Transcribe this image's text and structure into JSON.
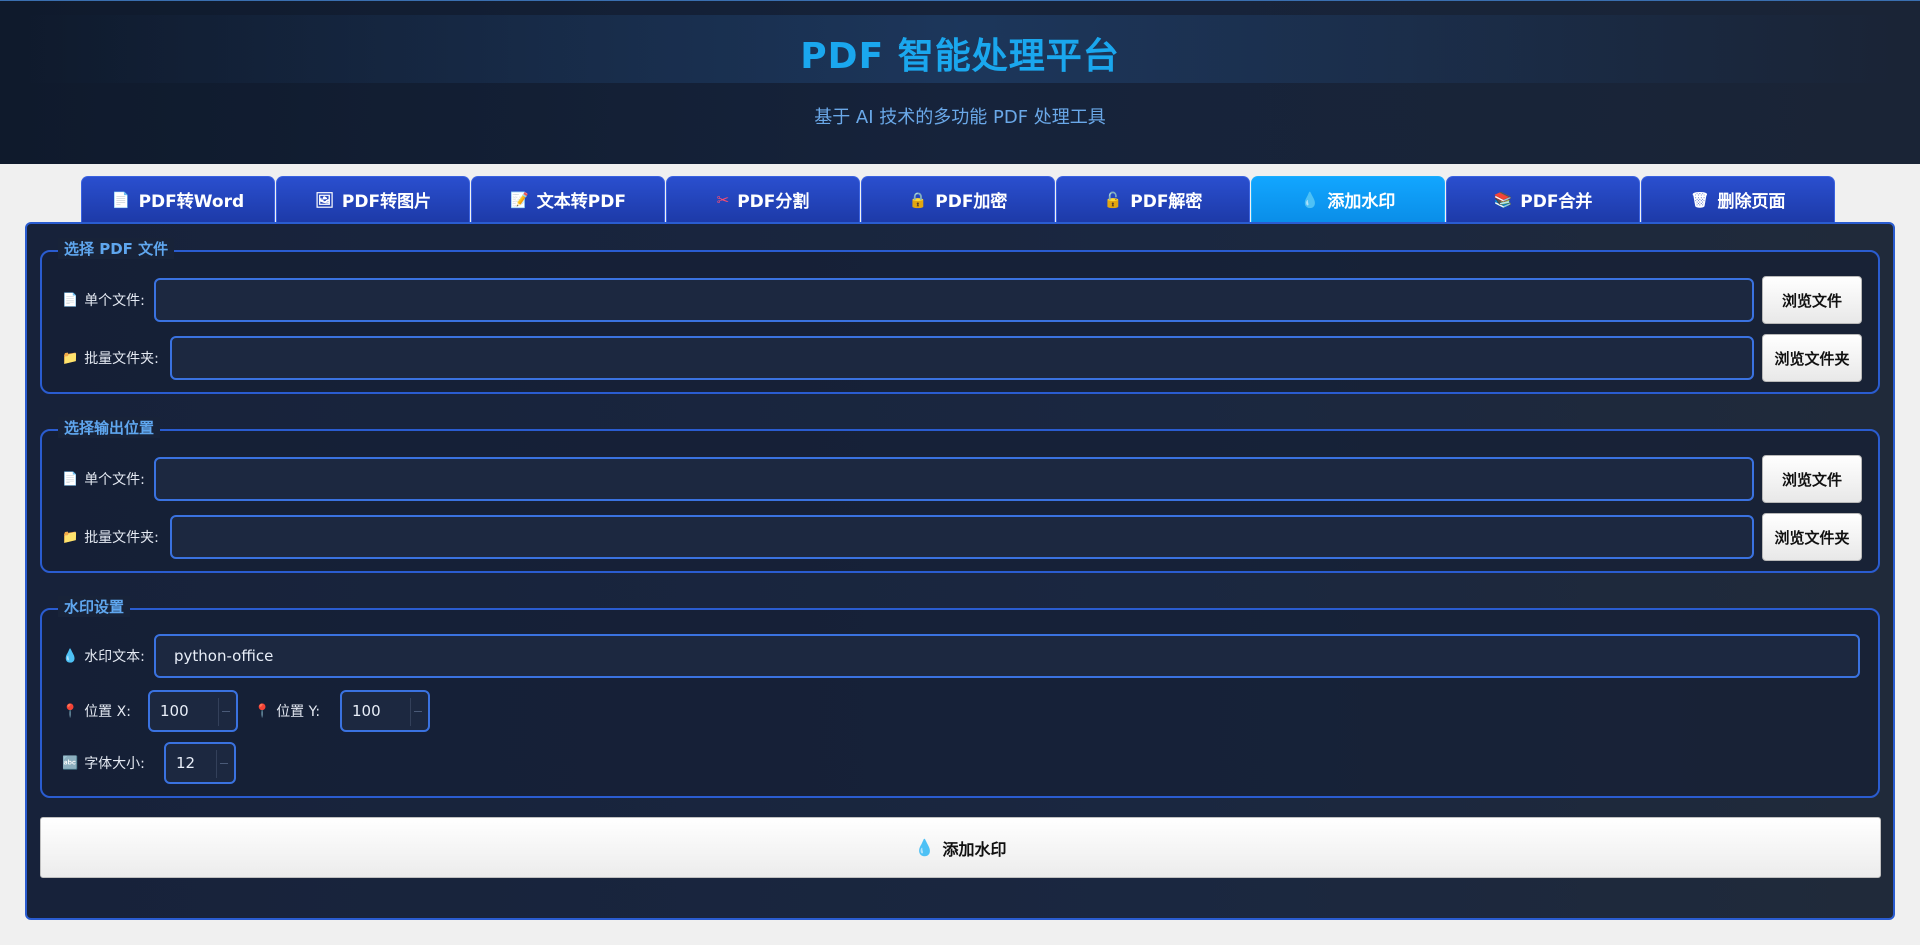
{
  "header": {
    "title": "PDF 智能处理平台",
    "subtitle": "基于 AI 技术的多功能 PDF 处理工具"
  },
  "tabs": [
    {
      "label": "PDF转Word",
      "icon": "📄",
      "icon_name": "document-icon"
    },
    {
      "label": "PDF转图片",
      "icon": "🖼",
      "icon_name": "image-icon"
    },
    {
      "label": "文本转PDF",
      "icon": "📝",
      "icon_name": "memo-icon"
    },
    {
      "label": "PDF分割",
      "icon": "✂",
      "icon_name": "scissors-icon"
    },
    {
      "label": "PDF加密",
      "icon": "🔒",
      "icon_name": "lock-icon"
    },
    {
      "label": "PDF解密",
      "icon": "🔓",
      "icon_name": "unlock-icon"
    },
    {
      "label": "添加水印",
      "icon": "💧",
      "icon_name": "droplet-icon",
      "active": true
    },
    {
      "label": "PDF合并",
      "icon": "📚",
      "icon_name": "books-icon"
    },
    {
      "label": "删除页面",
      "icon": "🗑",
      "icon_name": "trash-icon"
    }
  ],
  "input_group": {
    "title": "选择 PDF 文件",
    "single_label": "单个文件:",
    "single_value": "",
    "batch_label": "批量文件夹:",
    "batch_value": "",
    "browse_file": "浏览文件",
    "browse_folder": "浏览文件夹"
  },
  "output_group": {
    "title": "选择输出位置",
    "single_label": "单个文件:",
    "single_value": "",
    "batch_label": "批量文件夹:",
    "batch_value": "",
    "browse_file": "浏览文件",
    "browse_folder": "浏览文件夹"
  },
  "watermark": {
    "title": "水印设置",
    "text_label": "水印文本:",
    "text_value": "python-office",
    "pos_x_label": "位置 X:",
    "pos_x_value": "100",
    "pos_y_label": "位置 Y:",
    "pos_y_value": "100",
    "font_size_label": "字体大小:",
    "font_size_value": "12"
  },
  "action": {
    "label": "添加水印",
    "icon": "💧"
  },
  "icons": {
    "file": "📄",
    "folder": "📁",
    "droplet": "💧",
    "pin": "📍",
    "font_size": "🔤"
  },
  "colors": {
    "accent": "#1aa7ee",
    "tab_bg": "#2a4fcf",
    "tab_active": "#12a6ff",
    "border": "#2a5cd0",
    "panel_bg": "#17223a"
  }
}
